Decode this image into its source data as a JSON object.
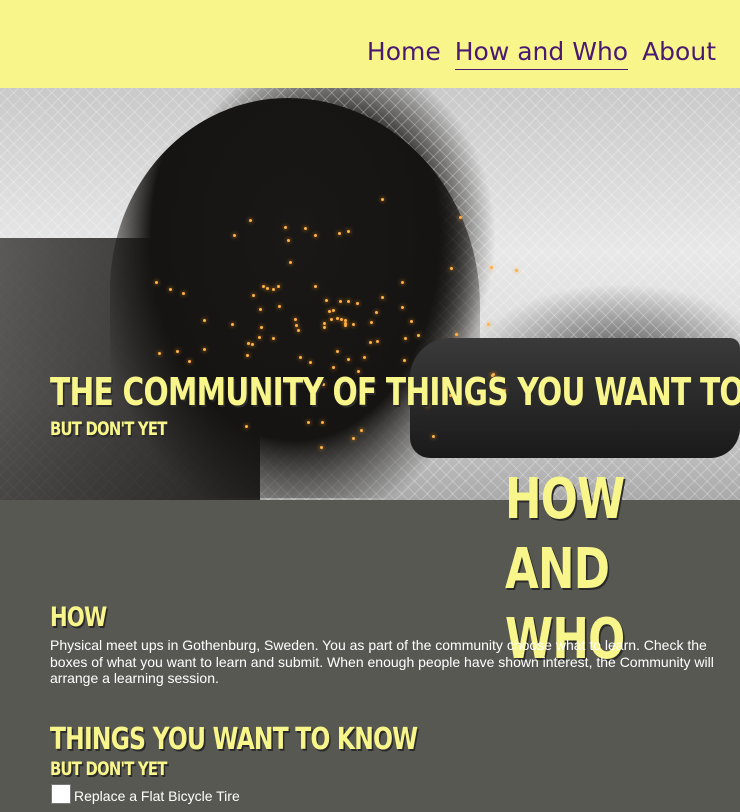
{
  "nav": {
    "items": [
      {
        "label": "Home",
        "active": false
      },
      {
        "label": "How and Who",
        "active": true
      },
      {
        "label": "About",
        "active": false
      }
    ]
  },
  "hero": {
    "title": "THE COMMUNITY OF THINGS YOU WANT TO KNOW",
    "subtitle": "BUT DON'T YET"
  },
  "section": {
    "title": "HOW AND WHO",
    "how_heading": "HOW",
    "how_text": "Physical meet ups in Gothenburg, Sweden. You as part of the community choose what to learn. Check the boxes of what you want to learn and submit. When enough people have shown interest, the Community will arrange a learning session.",
    "things_heading": "THINGS YOU WANT TO KNOW",
    "things_sub": "BUT DON'T YET",
    "options": [
      {
        "label": "Replace a Flat Bicycle Tire",
        "checked": false
      }
    ]
  },
  "colors": {
    "accent_yellow": "#f8f68b",
    "nav_text": "#4a1a72",
    "body_bg": "#585853"
  }
}
